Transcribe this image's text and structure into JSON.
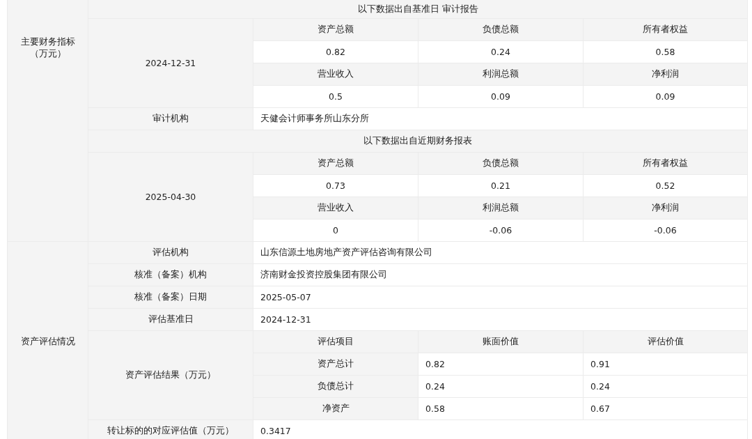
{
  "financial": {
    "label": "主要财务指标（万元）",
    "periods": [
      {
        "source_note": "以下数据出自基准日 审计报告",
        "date": "2024-12-31",
        "metrics": [
          {
            "label": "资产总额",
            "value": "0.82"
          },
          {
            "label": "负债总额",
            "value": "0.24"
          },
          {
            "label": "所有者权益",
            "value": "0.58"
          },
          {
            "label": "营业收入",
            "value": "0.5"
          },
          {
            "label": "利润总额",
            "value": "0.09"
          },
          {
            "label": "净利润",
            "value": "0.09"
          }
        ],
        "extra_rows": [
          {
            "label": "审计机构",
            "value": "天健会计师事务所山东分所"
          }
        ]
      },
      {
        "source_note": "以下数据出自近期财务报表",
        "date": "2025-04-30",
        "metrics": [
          {
            "label": "资产总额",
            "value": "0.73"
          },
          {
            "label": "负债总额",
            "value": "0.21"
          },
          {
            "label": "所有者权益",
            "value": "0.52"
          },
          {
            "label": "营业收入",
            "value": "0"
          },
          {
            "label": "利润总额",
            "value": "-0.06"
          },
          {
            "label": "净利润",
            "value": "-0.06"
          }
        ]
      }
    ]
  },
  "valuation": {
    "label": "资产评估情况",
    "info_rows": [
      {
        "label": "评估机构",
        "value": "山东信源土地房地产资产评估咨询有限公司"
      },
      {
        "label": "核准（备案）机构",
        "value": "济南财金投资控股集团有限公司"
      },
      {
        "label": "核准（备案）日期",
        "value": "2025-05-07"
      },
      {
        "label": "评估基准日",
        "value": "2024-12-31"
      }
    ],
    "result": {
      "label": "资产评估结果（万元）",
      "columns": [
        "评估项目",
        "账面价值",
        "评估价值"
      ],
      "rows": [
        {
          "item": "资产总计",
          "book": "0.82",
          "appraised": "0.91"
        },
        {
          "item": "负债总计",
          "book": "0.24",
          "appraised": "0.24"
        },
        {
          "item": "净资产",
          "book": "0.58",
          "appraised": "0.67"
        }
      ]
    },
    "transfer": {
      "label": "转让标的的对应评估值（万元）",
      "value": "0.3417"
    }
  }
}
